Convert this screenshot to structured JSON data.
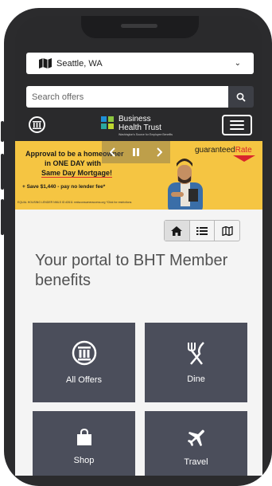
{
  "location": {
    "city": "Seattle, WA"
  },
  "search": {
    "placeholder": "Search offers"
  },
  "brand": {
    "line1": "Business",
    "line2": "Health Trust",
    "tagline": "Washington's Source for Employee Benefits",
    "colors": {
      "green": "#8cc63f",
      "blue": "#1f8fd6",
      "teal": "#2aa7a0",
      "lime": "#bfd730"
    }
  },
  "banner": {
    "line1": "Approval to be a homeowner",
    "line2": "in ONE DAY with",
    "line3": "Same Day Mortgage!",
    "line4": "+ Save $1,440 - pay no lender fee*",
    "fine_print": "EQUAL HOUSING LENDER NMLS ID #2611 nmlsconsumeraccess.org *Click for restrictions",
    "brand_text_a": "guaranteed",
    "brand_text_b": "Rate",
    "colors": {
      "background": "#f5c542",
      "accent": "#d9252c"
    }
  },
  "carousel": {
    "prev_icon": "chevron-left-icon",
    "pause_icon": "pause-icon",
    "next_icon": "chevron-right-icon"
  },
  "view_toggle": {
    "active": "home"
  },
  "portal": {
    "title": "Your portal to BHT Member benefits"
  },
  "tiles": [
    {
      "label": "All Offers",
      "icon": "building-seal-icon"
    },
    {
      "label": "Dine",
      "icon": "utensils-icon"
    },
    {
      "label": "Shop",
      "icon": "shopping-bag-icon"
    },
    {
      "label": "Travel",
      "icon": "plane-icon"
    }
  ],
  "colors": {
    "tile": "#4b4e5b",
    "text_dark": "#525252"
  }
}
